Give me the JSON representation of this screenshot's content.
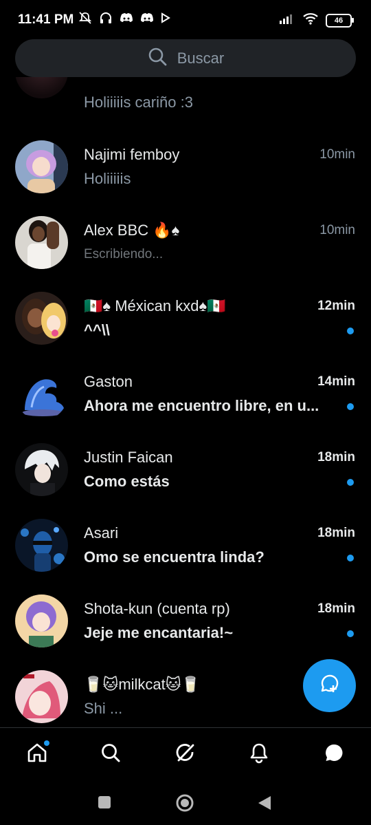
{
  "status_bar": {
    "time": "11:41 PM",
    "battery": "46",
    "icons": [
      "mute-icon",
      "headphones-icon",
      "discord-icon",
      "discord-icon",
      "play-icon",
      "signal-icon",
      "wifi-icon",
      "battery-icon"
    ]
  },
  "search": {
    "placeholder": "Buscar"
  },
  "conversations": [
    {
      "name": "",
      "preview": "Holiiiiis cariño :3",
      "time": "",
      "unread": false
    },
    {
      "name": "Najimi femboy",
      "preview": "Holiiiiis",
      "time": "10min",
      "unread": false
    },
    {
      "name": "Alex BBC 🔥♠",
      "preview": "Escribiendo...",
      "time": "10min",
      "unread": false,
      "typing": true
    },
    {
      "name": "🇲🇽♠ Méxican kxd♠🇲🇽",
      "preview": "^^\\\\",
      "time": "12min",
      "unread": true
    },
    {
      "name": "Gaston",
      "preview": "Ahora me encuentro libre, en u...",
      "time": "14min",
      "unread": true
    },
    {
      "name": "Justin Faican",
      "preview": "Como estás",
      "time": "18min",
      "unread": true
    },
    {
      "name": "Asari",
      "preview": "Omo se encuentra linda?",
      "time": "18min",
      "unread": true
    },
    {
      "name": "Shota-kun (cuenta rp)",
      "preview": "Jeje me encantaria!~",
      "time": "18min",
      "unread": true
    },
    {
      "name": "🥛🐱milkcat🐱🥛",
      "preview": "Shi ...",
      "time": "",
      "unread": false
    }
  ],
  "fab": {
    "icon": "new-message-icon"
  },
  "bottom_nav": [
    "home-icon",
    "search-icon",
    "grok-icon",
    "notifications-icon",
    "messages-icon"
  ],
  "system_nav": [
    "recents-icon",
    "home-circle-icon",
    "back-icon"
  ],
  "colors": {
    "accent": "#1d9bf0",
    "background": "#000000",
    "muted": "#8b98a5"
  }
}
